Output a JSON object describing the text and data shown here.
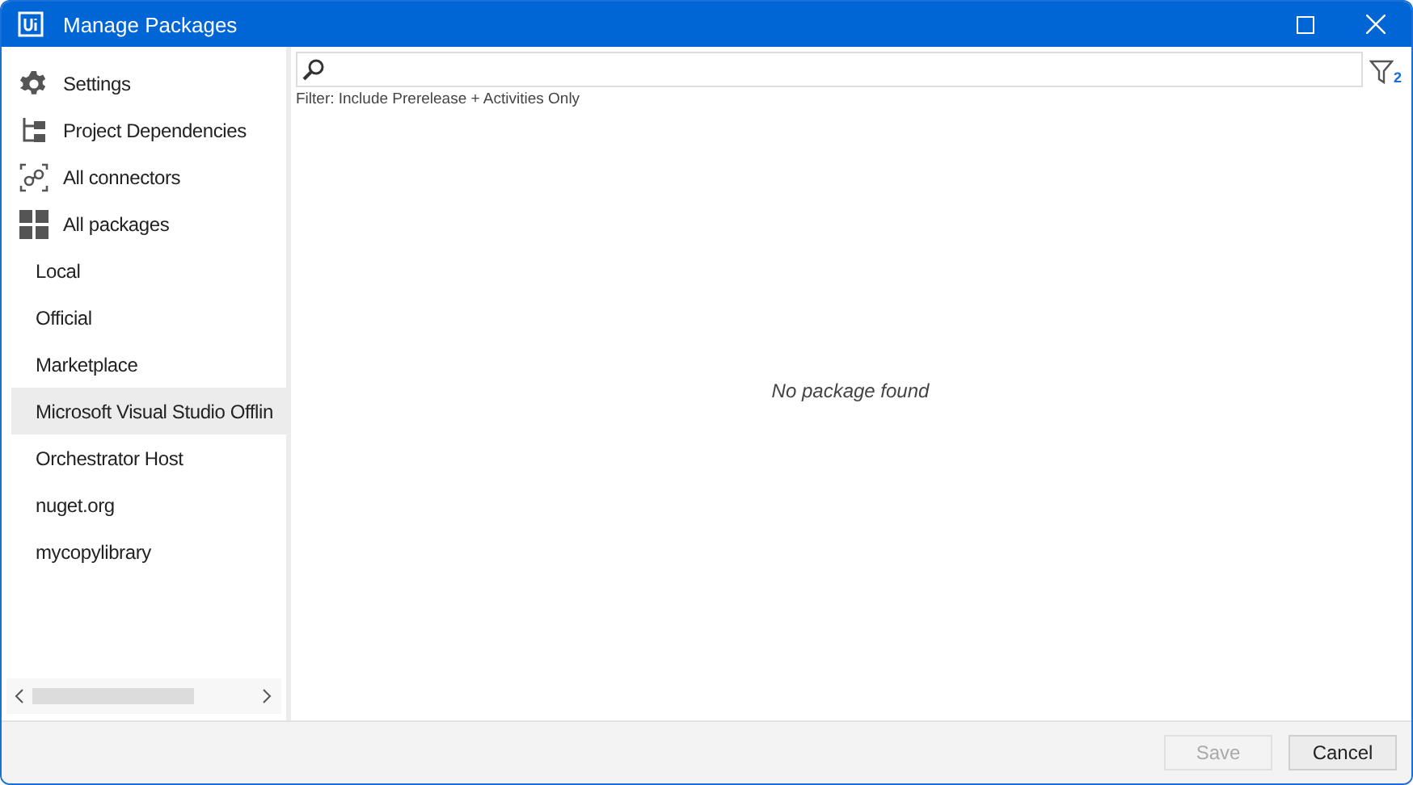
{
  "window": {
    "title": "Manage Packages"
  },
  "sidebar": {
    "items": [
      {
        "label": "Settings",
        "kind": "settings",
        "selected": false
      },
      {
        "label": "Project Dependencies",
        "kind": "dependencies",
        "selected": false
      },
      {
        "label": "All connectors",
        "kind": "connectors",
        "selected": false
      },
      {
        "label": "All packages",
        "kind": "packages",
        "selected": false
      },
      {
        "label": "Local",
        "kind": "source",
        "selected": false
      },
      {
        "label": "Official",
        "kind": "source",
        "selected": false
      },
      {
        "label": "Marketplace",
        "kind": "source",
        "selected": false
      },
      {
        "label": "Microsoft Visual Studio Offlin",
        "kind": "source",
        "selected": true
      },
      {
        "label": "Orchestrator Host",
        "kind": "source",
        "selected": false
      },
      {
        "label": "nuget.org",
        "kind": "source",
        "selected": false
      },
      {
        "label": "mycopylibrary",
        "kind": "source",
        "selected": false
      }
    ]
  },
  "search": {
    "filter_count": "2",
    "filter_text": "Filter: Include Prerelease + Activities Only"
  },
  "empty_message": "No package found",
  "buttons": [
    {
      "label": "Save",
      "disabled": true
    },
    {
      "label": "Cancel",
      "disabled": false
    }
  ]
}
